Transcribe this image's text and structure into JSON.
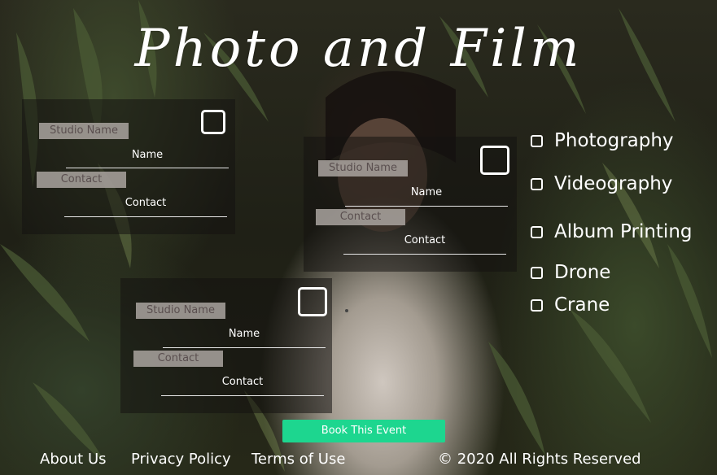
{
  "title": "Photo and Film",
  "cards": [
    {
      "studio_label": "Studio Name",
      "name_label": "Name",
      "contact_pill": "Contact",
      "contact_label": "Contact"
    },
    {
      "studio_label": "Studio Name",
      "name_label": "Name",
      "contact_pill": "Contact",
      "contact_label": "Contact"
    },
    {
      "studio_label": "Studio Name",
      "name_label": "Name",
      "contact_pill": "Contact",
      "contact_label": "Contact"
    }
  ],
  "services": [
    {
      "label": "Photography"
    },
    {
      "label": "Videography"
    },
    {
      "label": "Album Printing"
    },
    {
      "label": "Drone"
    },
    {
      "label": "Crane"
    }
  ],
  "book_button": "Book This Event",
  "footer": {
    "about": "About Us",
    "privacy": "Privacy Policy",
    "terms": "Terms of Use",
    "copyright": "© 2020 All Rights Reserved"
  },
  "colors": {
    "accent": "#1dd68f"
  }
}
